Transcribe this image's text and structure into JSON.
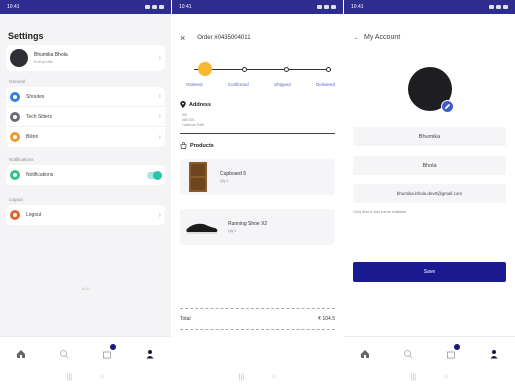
{
  "status": {
    "time": "10:41"
  },
  "settings_screen": {
    "title": "Settings",
    "profile": {
      "name": "Bhumika Bhola",
      "subtitle": "Edit profile"
    },
    "groups": [
      {
        "label": "General",
        "items": [
          {
            "label": "Shoutes",
            "color": "#2f7fe6"
          },
          {
            "label": "Tech Sitters",
            "color": "#6b6b74"
          },
          {
            "label": "Bilinn",
            "color": "#f19a2c"
          }
        ]
      },
      {
        "label": "Notifications",
        "items": [
          {
            "label": "Notifications",
            "color": "#36c283",
            "toggle": true
          }
        ]
      },
      {
        "label": "Logout",
        "items": [
          {
            "label": "Logout",
            "color": "#e8632e"
          }
        ]
      }
    ],
    "version": "- v1.0 -"
  },
  "order_screen": {
    "title": "Order #0435004011",
    "steps": [
      "Ordered",
      "Confirmed",
      "Shipped",
      "Delivered"
    ],
    "address_heading": "Address",
    "address_lines": [
      "Vill",
      "485 001",
      "Lucknow Patti"
    ],
    "products_heading": "Products",
    "products": [
      {
        "name": "Cupboard 5",
        "qty": "Qty 1"
      },
      {
        "name": "Running Shoe X2",
        "qty": "Qty 1"
      }
    ],
    "total_label": "Total",
    "total_value": "₹ 104.5"
  },
  "account_screen": {
    "title": "My Account",
    "fields": [
      "Bhumika",
      "Bhola",
      "bhumika.bhola.dev0@gmail.com"
    ],
    "hint": "Only first & last name editable",
    "save_label": "Save"
  },
  "nav": {
    "icons": [
      "home-icon",
      "search-icon",
      "cart-icon",
      "profile-icon"
    ]
  },
  "colors": {
    "primary": "#2e2c8f",
    "button": "#1a1a90",
    "toggle": "#2cc3ad",
    "step_active": "#f6b731"
  }
}
